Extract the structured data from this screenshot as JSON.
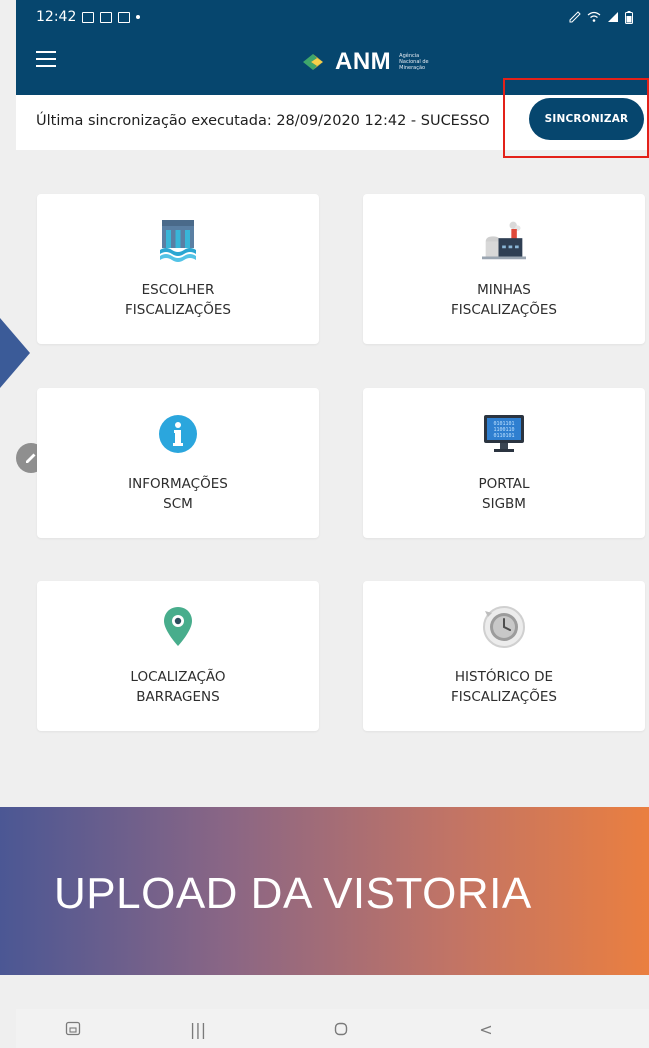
{
  "status_bar": {
    "time": "12:42",
    "notification_icons": [
      "image-icon",
      "media-icon",
      "gallery-icon",
      "dot-icon"
    ],
    "system_icons": [
      "edit-pen-icon",
      "wifi-icon",
      "signal-icon",
      "battery-icon"
    ]
  },
  "app_bar": {
    "menu_icon": "hamburger-menu-icon",
    "logo_text": "ANM",
    "logo_subtitle": [
      "Agência",
      "Nacional de",
      "Mineração"
    ]
  },
  "sync": {
    "status_text": "Última sincronização executada: 28/09/2020 12:42 - SUCESSO",
    "button_label": "SINCRONIZAR"
  },
  "tiles": [
    {
      "id": "escolher",
      "line1": "ESCOLHER",
      "line2": "FISCALIZAÇÕES",
      "icon": "dam-icon"
    },
    {
      "id": "minhas",
      "line1": "MINHAS",
      "line2": "FISCALIZAÇÕES",
      "icon": "factory-icon"
    },
    {
      "id": "informacoes",
      "line1": "INFORMAÇÕES",
      "line2": "SCM",
      "icon": "info-icon"
    },
    {
      "id": "portal",
      "line1": "PORTAL",
      "line2": "SIGBM",
      "icon": "monitor-icon"
    },
    {
      "id": "localizacao",
      "line1": "LOCALIZAÇÃO",
      "line2": "BARRAGENS",
      "icon": "map-pin-icon"
    },
    {
      "id": "historico",
      "line1": "HISTÓRICO DE",
      "line2": "FISCALIZAÇÕES",
      "icon": "history-clock-icon"
    }
  ],
  "banner": {
    "text": "UPLOAD DA VISTORIA"
  },
  "nav_bar": {
    "items": [
      "screen-icon",
      "recents-icon",
      "home-icon",
      "back-icon"
    ],
    "recents_glyph": "|||",
    "back_glyph": "<"
  },
  "colors": {
    "header": "#06466e",
    "accent_red": "#e32119",
    "tile_bg": "#ffffff",
    "page_bg": "#efefef"
  }
}
